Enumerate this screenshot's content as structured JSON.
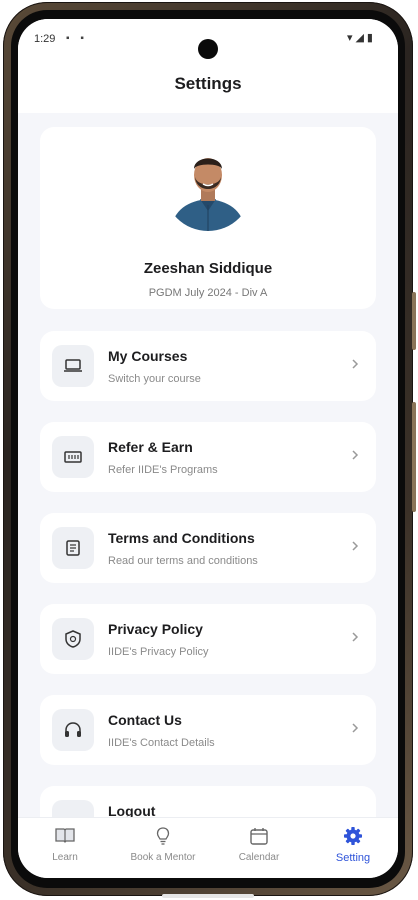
{
  "statusbar": {
    "time": "1:29"
  },
  "appbar": {
    "title": "Settings"
  },
  "profile": {
    "name": "Zeeshan Siddique",
    "subtitle": "PGDM July 2024 - Div A"
  },
  "menu": [
    {
      "title": "My Courses",
      "subtitle": "Switch your course",
      "icon": "laptop-icon"
    },
    {
      "title": "Refer & Earn",
      "subtitle": "Refer IIDE's Programs",
      "icon": "ticket-icon"
    },
    {
      "title": "Terms and Conditions",
      "subtitle": "Read our terms and conditions",
      "icon": "document-icon"
    },
    {
      "title": "Privacy Policy",
      "subtitle": "IIDE's Privacy Policy",
      "icon": "shield-icon"
    },
    {
      "title": "Contact Us",
      "subtitle": "IIDE's Contact Details",
      "icon": "headset-icon"
    },
    {
      "title": "Logout",
      "subtitle": "",
      "icon": "logout-icon"
    }
  ],
  "bottom_nav": [
    {
      "label": "Learn",
      "icon": "book-icon",
      "active": false
    },
    {
      "label": "Book a Mentor",
      "icon": "lightbulb-icon",
      "active": false
    },
    {
      "label": "Calendar",
      "icon": "calendar-icon",
      "active": false
    },
    {
      "label": "Setting",
      "icon": "gear-icon",
      "active": true
    }
  ],
  "colors": {
    "accent": "#2f54d9",
    "background": "#f5f6fa",
    "card": "#ffffff"
  }
}
